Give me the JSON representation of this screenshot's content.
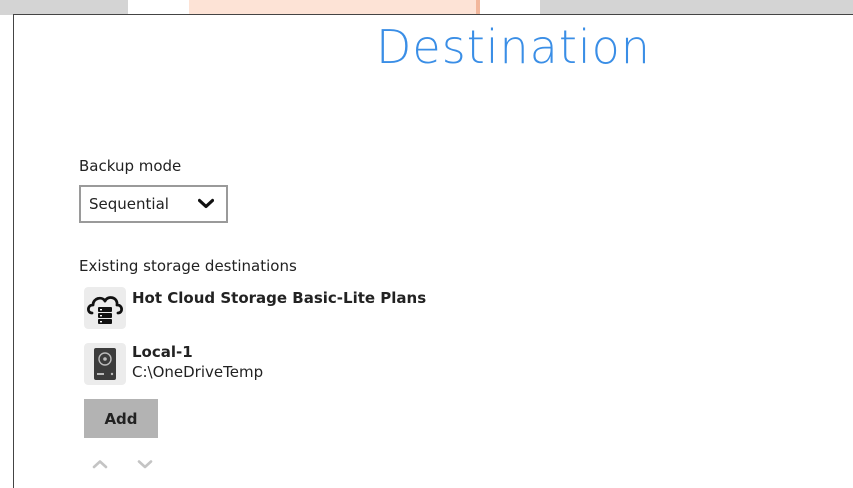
{
  "page": {
    "title": "Destination"
  },
  "backup_mode": {
    "label": "Backup mode",
    "selected": "Sequential"
  },
  "destinations": {
    "label": "Existing storage destinations",
    "items": [
      {
        "name": "Hot Cloud Storage Basic-Lite Plans",
        "path": "",
        "icon": "cloud-storage-icon"
      },
      {
        "name": "Local-1",
        "path": "C:\\OneDriveTemp",
        "icon": "local-drive-icon"
      }
    ],
    "add_label": "Add"
  },
  "colors": {
    "title": "#3a8ee6",
    "add_button": "#b3b3b3",
    "active_tab": "#fde3d6"
  }
}
